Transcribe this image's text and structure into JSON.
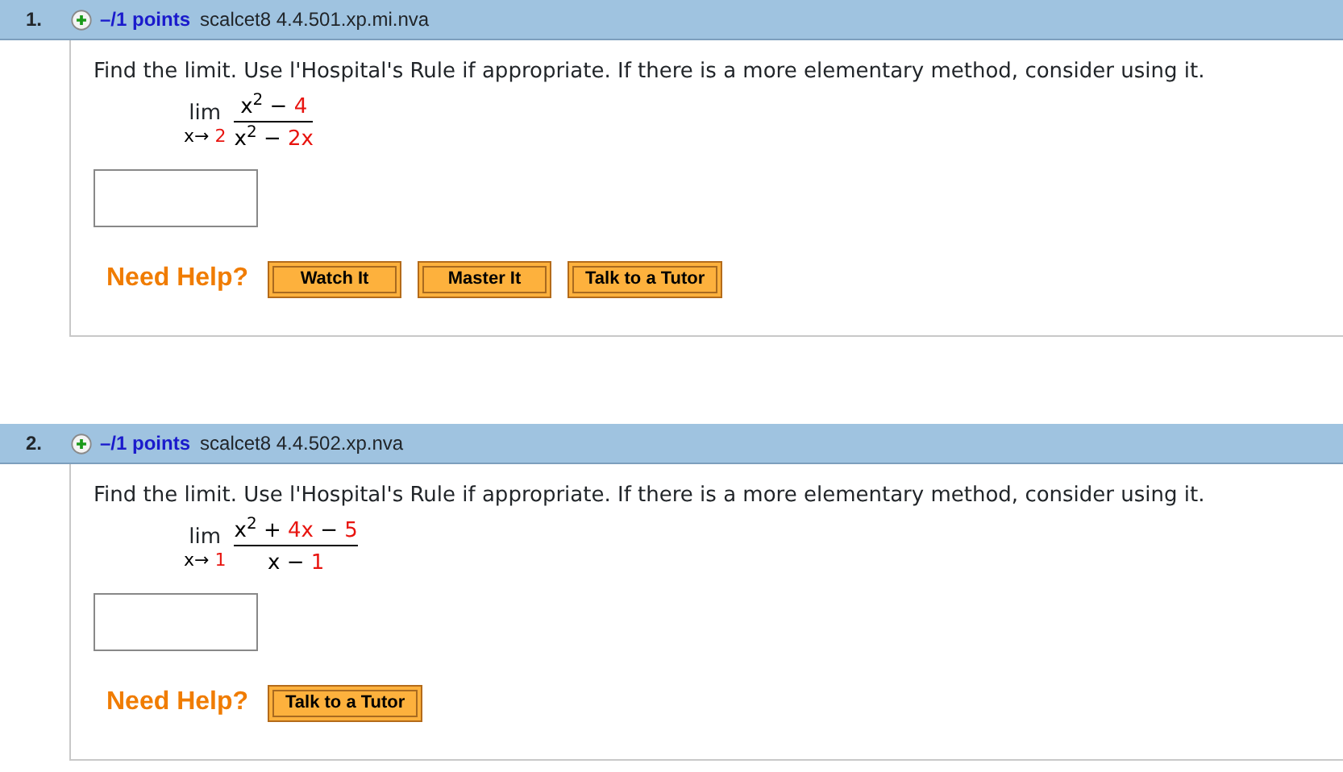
{
  "questions": [
    {
      "number": "1.",
      "points": "–/1 points",
      "code": "scalcet8 4.4.501.xp.mi.nva",
      "prompt": "Find the limit. Use l'Hospital's Rule if appropriate. If there is a more elementary method, consider using it.",
      "limit": {
        "operator": "lim",
        "approach": [
          {
            "text": "x→",
            "kind": "variable"
          },
          {
            "text": "2",
            "kind": "constant"
          }
        ],
        "numerator": [
          {
            "text": "x$^{2}$ −",
            "kind": "variable"
          },
          {
            "text": "4",
            "kind": "constant"
          }
        ],
        "denominator": [
          {
            "text": "x$^{2}$ −",
            "kind": "variable"
          },
          {
            "text": "2x",
            "kind": "constant"
          }
        ]
      },
      "help_label": "Need Help?",
      "help_buttons": [
        "Watch It",
        "Master It",
        "Talk to a Tutor"
      ]
    },
    {
      "number": "2.",
      "points": "–/1 points",
      "code": "scalcet8 4.4.502.xp.nva",
      "prompt": "Find the limit. Use l'Hospital's Rule if appropriate. If there is a more elementary method, consider using it.",
      "limit": {
        "operator": "lim",
        "approach": [
          {
            "text": "x→",
            "kind": "variable"
          },
          {
            "text": "1",
            "kind": "constant"
          }
        ],
        "numerator": [
          {
            "text": "x$^{2}$ +",
            "kind": "variable"
          },
          {
            "text": "4x",
            "kind": "constant"
          },
          {
            "text": "−",
            "kind": "variable"
          },
          {
            "text": "5",
            "kind": "constant"
          }
        ],
        "denominator": [
          {
            "text": "x −",
            "kind": "variable"
          },
          {
            "text": "1",
            "kind": "constant"
          }
        ]
      },
      "help_label": "Need Help?",
      "help_buttons": [
        "Talk to a Tutor"
      ]
    }
  ]
}
